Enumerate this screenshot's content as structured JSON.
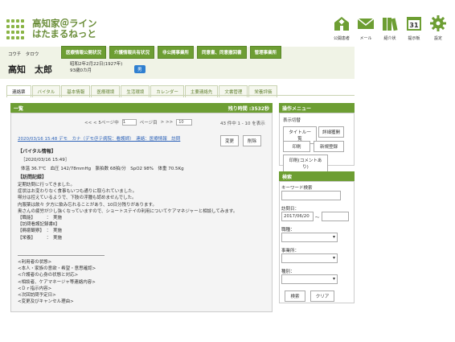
{
  "app": {
    "title_line1": "高知家＠ライン",
    "title_line2": "はたまるねっと"
  },
  "topnav": [
    {
      "label": "公開患者",
      "icon": "hospital-icon"
    },
    {
      "label": "メール",
      "icon": "mail-icon"
    },
    {
      "label": "紹介状",
      "icon": "books-icon"
    },
    {
      "label": "提示板",
      "icon": "calendar-icon"
    },
    {
      "label": "設定",
      "icon": "gear-icon"
    }
  ],
  "calendar_day": "31",
  "status_buttons": [
    "医療情報公開状況",
    "介護情報共有状況",
    "非公開事業所",
    "同意書、同意撤回書",
    "管理事業所"
  ],
  "patient": {
    "kana": "コウチ　タロウ",
    "name": "高知　太郎",
    "birth": "昭和2年2月22日(1927年)",
    "age": "93歳0カ月",
    "gender": "男"
  },
  "tabs": [
    "連絡票",
    "バイタル",
    "基本情報",
    "医療環境",
    "生活環境",
    "カレンダー",
    "主要連絡先",
    "文書管理",
    "栄養評価"
  ],
  "panel": {
    "title": "一覧",
    "remaining": "残り時間 :3532秒"
  },
  "pager": {
    "prev": "<< < 5ページ中",
    "page": "1",
    "pages_label": "ページ目",
    "next": "> >>",
    "per_page": "10",
    "count": "43 件中 1 - 10 を表示"
  },
  "entry": {
    "link": "2020/03/16 15:48 デモ　カナ（デモ＠テ病院：看護師）　連絡：医療情報　訪問",
    "edit": "変更",
    "delete": "削除",
    "vital_title": "【バイタル情報】",
    "vital_date": "［2020/03/16 15:49］",
    "vital_values": "体温 36.7℃　血圧 142/78mmHg　脈拍数 68拍/分　SpO2 98%　体重 70.5Kg",
    "visit_title": "【訪問記録】",
    "visit_body": "定期訪問に行ってきました。\n症状はお変わりなく食事もいつも通りに取られていました。\n嚥分は控えているようで、下肢の浮腫も認めませんでした。\n内服薬は飲々 夕方に飲み忘れることがあり、10日分残りがあります。\n奥さんの疲労が少し強くなっていますので、ショートステイの利用についてケアマネジャーと相談してみます。\n【職能】　　　：　実施\n【訪問看護記録書Ⅱ】\n【褥瘡観察】　：　実施\n【栄養】　　　：　実施",
    "tags": "<利用者の状態>\n<本人・家族の意欲・希望・意思確認>\n<介護者の心身の状態と対応>\n<相談者、ケアマネージャ等連絡内容>\n<Ｄｒ指示内容>\n<次回訪問予定日>\n<変更及びキャンセル理由>"
  },
  "side_menu": {
    "title": "操作メニュー",
    "display_switch": "表示切替",
    "title_list": "タイトル一覧",
    "detail": "詳細獲開",
    "print": "印刷",
    "new": "新規登録",
    "print_comment": "印刷(コメントあり)"
  },
  "search": {
    "title": "検索",
    "keyword_label": "キーワード検索",
    "date_label": "訪問日：",
    "date_from": "2017/06/20",
    "tilde": "～",
    "job_label": "職種：",
    "org_label": "事業所：",
    "type_label": "種別：",
    "search_btn": "検索",
    "clear_btn": "クリア"
  }
}
